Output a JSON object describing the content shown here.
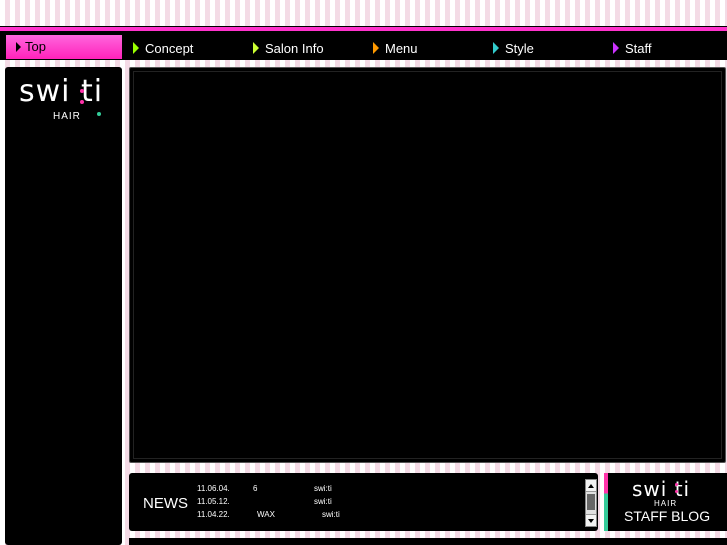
{
  "nav": {
    "top_label": "Top",
    "items": [
      {
        "label": "Concept",
        "icon": "triangle-right-icon",
        "color": "#99ff00"
      },
      {
        "label": "Salon Info",
        "icon": "triangle-right-icon",
        "color": "#ccff33"
      },
      {
        "label": "Menu",
        "icon": "triangle-right-icon",
        "color": "#ff9900"
      },
      {
        "label": "Style",
        "icon": "triangle-right-icon",
        "color": "#33cccc"
      },
      {
        "label": "Staff",
        "icon": "triangle-right-icon",
        "color": "#cc33ff"
      }
    ]
  },
  "logo": {
    "word": "swi ti",
    "sub": "HAIR"
  },
  "news": {
    "title": "NEWS",
    "rows": [
      {
        "date": "11.06.04.",
        "col2": "6",
        "col3": "swi:ti"
      },
      {
        "date": "11.05.12.",
        "col2": "",
        "col3": "swi:ti"
      },
      {
        "date": "11.04.22.",
        "col2": "WAX",
        "col3": "swi:ti"
      }
    ]
  },
  "blog": {
    "word": "swi ti",
    "sub": "HAIR",
    "title": "STAFF BLOG"
  },
  "colors": {
    "accent": "#ff33cc",
    "panel": "#000000"
  }
}
